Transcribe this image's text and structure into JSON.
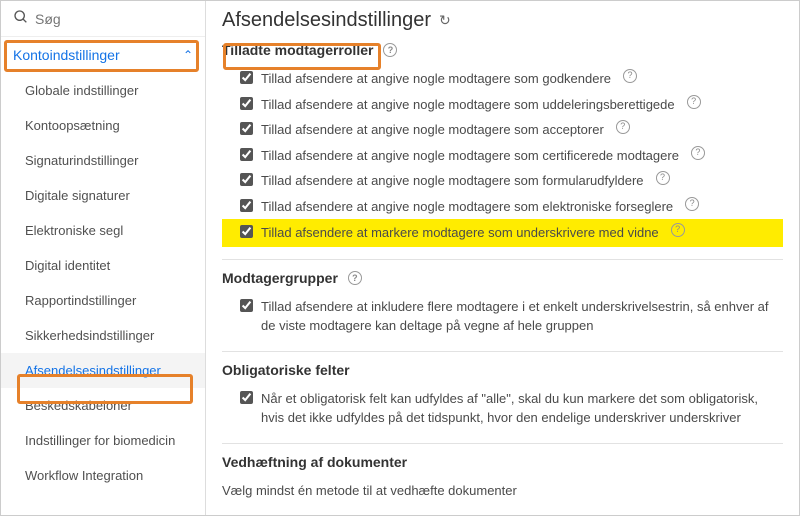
{
  "search": {
    "placeholder": "Søg"
  },
  "sidebar": {
    "header": "Kontoindstillinger",
    "items": [
      "Globale indstillinger",
      "Kontoopsætning",
      "Signaturindstillinger",
      "Digitale signaturer",
      "Elektroniske segl",
      "Digital identitet",
      "Rapportindstillinger",
      "Sikkerhedsindstillinger",
      "Afsendelsesindstillinger",
      "Beskedskabeloner",
      "Indstillinger for biomedicin",
      "Workflow Integration"
    ],
    "activeIndex": 8
  },
  "page": {
    "title": "Afsendelsesindstillinger"
  },
  "sections": {
    "roles": {
      "title": "Tilladte modtagerroller",
      "items": [
        "Tillad afsendere at angive nogle modtagere som godkendere",
        "Tillad afsendere at angive nogle modtagere som uddeleringsberettigede",
        "Tillad afsendere at angive nogle modtagere som acceptorer",
        "Tillad afsendere at angive nogle modtagere som certificerede modtagere",
        "Tillad afsendere at angive nogle modtagere som formularudfyldere",
        "Tillad afsendere at angive nogle modtagere som elektroniske forseglere",
        "Tillad afsendere at markere modtagere som underskrivere med vidne"
      ],
      "hlIndex": 6
    },
    "groups": {
      "title": "Modtagergrupper",
      "item": "Tillad afsendere at inkludere flere modtagere i et enkelt underskrivelsestrin, så enhver af de viste modtagere kan deltage på vegne af hele gruppen"
    },
    "mandatory": {
      "title": "Obligatoriske felter",
      "item": "Når et obligatorisk felt kan udfyldes af \"alle\", skal du kun markere det som obligatorisk, hvis det ikke udfyldes på det tidspunkt, hvor den endelige underskriver underskriver"
    },
    "attach": {
      "title": "Vedhæftning af dokumenter",
      "desc": "Vælg mindst én metode til at vedhæfte dokumenter"
    }
  }
}
